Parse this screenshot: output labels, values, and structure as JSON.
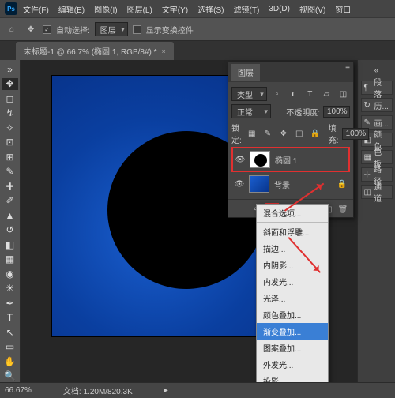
{
  "menu": {
    "items": [
      "文件(F)",
      "编辑(E)",
      "图像(I)",
      "图层(L)",
      "文字(Y)",
      "选择(S)",
      "滤镜(T)",
      "3D(D)",
      "视图(V)",
      "窗口"
    ]
  },
  "options": {
    "auto_select": "自动选择:",
    "group": "图层",
    "show_transform": "显示变换控件"
  },
  "tab": {
    "title": "未标题-1 @ 66.7% (椭圆 1, RGB/8#) *"
  },
  "dock": {
    "items": [
      "段落",
      "历...",
      "画...",
      "颜色",
      "色板",
      "路径",
      "通道"
    ]
  },
  "layers_panel": {
    "title": "图层",
    "kind": "类型",
    "blend": "正常",
    "opacity_label": "不透明度:",
    "opacity_val": "100%",
    "lock_label": "锁定:",
    "fill_label": "填充:",
    "fill_val": "100%",
    "layer1": "椭圆 1",
    "layer2": "背景"
  },
  "fx": {
    "items": [
      "混合选项...",
      "斜面和浮雕...",
      "描边...",
      "内阴影...",
      "内发光...",
      "光泽...",
      "颜色叠加...",
      "渐变叠加...",
      "图案叠加...",
      "外发光...",
      "投影..."
    ]
  },
  "status": {
    "zoom": "66.67%",
    "doc": "文档: 1.20M/820.3K"
  }
}
